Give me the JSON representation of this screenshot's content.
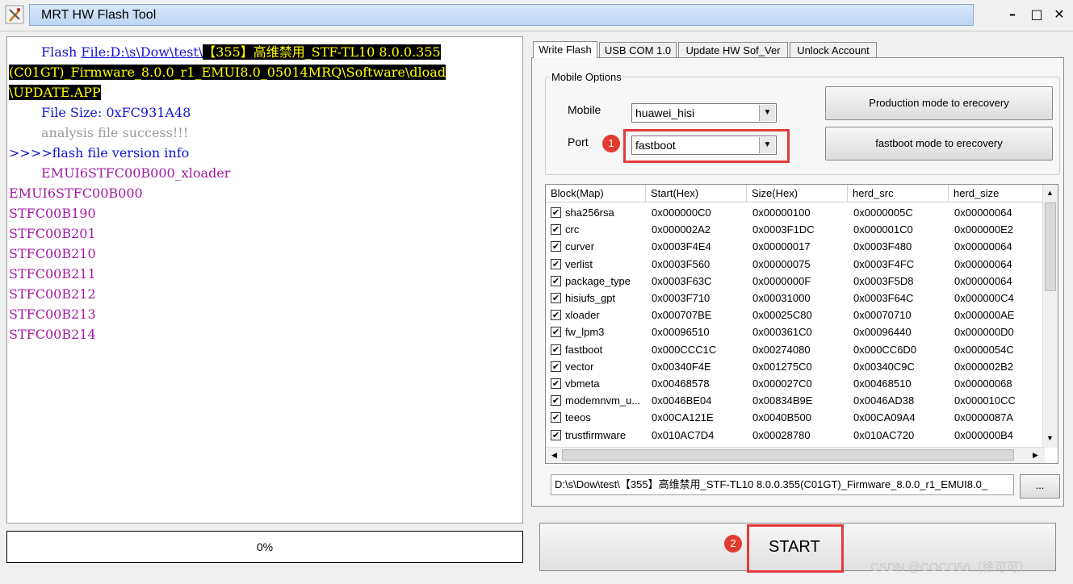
{
  "window": {
    "title": "MRT HW Flash Tool",
    "buttons": [
      "–",
      "□",
      "✕"
    ]
  },
  "log": {
    "lines": [
      {
        "prefix": "Flash ",
        "link": "File:D:\\s\\Dow\\test\\",
        "hl": "【355】高维禁用_STF-TL10 8.0.0.355"
      },
      {
        "hl": "(C01GT)_Firmware_8.0.0_r1_EMUI8.0_05014MRQ\\Software\\dload"
      },
      {
        "hl": "\\UPDATE.APP"
      },
      {
        "text": "File Size: 0xFC931A48",
        "color": "blue"
      },
      {
        "text": "analysis file success!!!",
        "color": "gray"
      },
      {
        "text": ">>>>flash file version info",
        "color": "blue"
      },
      {
        "text": "EMUI6STFC00B000_xloader",
        "color": "purple"
      },
      {
        "text": "EMUI6STFC00B000",
        "color": "purple"
      },
      {
        "text": "STFC00B190",
        "color": "purple"
      },
      {
        "text": "STFC00B201",
        "color": "purple"
      },
      {
        "text": "STFC00B210",
        "color": "purple"
      },
      {
        "text": "STFC00B211",
        "color": "purple"
      },
      {
        "text": "STFC00B212",
        "color": "purple"
      },
      {
        "text": "STFC00B213",
        "color": "purple"
      },
      {
        "text": "STFC00B214",
        "color": "purple"
      }
    ]
  },
  "progress": {
    "label": "0%",
    "value": 0
  },
  "tabs": [
    "Write Flash",
    "USB COM 1.0",
    "Update HW Sof_Ver",
    "Unlock Account"
  ],
  "mobile_options": {
    "group_label": "Mobile Options",
    "mobile_label": "Mobile",
    "mobile_value": "huawei_hisi",
    "port_label": "Port",
    "port_value": "fastboot",
    "production_button": "Production mode to erecovery",
    "fastboot_button": "fastboot mode to erecovery"
  },
  "badges": {
    "one": "1",
    "two": "2"
  },
  "table": {
    "headers": [
      "Block(Map)",
      "Start(Hex)",
      "Size(Hex)",
      "herd_src",
      "herd_size"
    ],
    "rows": [
      [
        "sha256rsa",
        "0x000000C0",
        "0x00000100",
        "0x0000005C",
        "0x00000064"
      ],
      [
        "crc",
        "0x000002A2",
        "0x0003F1DC",
        "0x000001C0",
        "0x000000E2"
      ],
      [
        "curver",
        "0x0003F4E4",
        "0x00000017",
        "0x0003F480",
        "0x00000064"
      ],
      [
        "verlist",
        "0x0003F560",
        "0x00000075",
        "0x0003F4FC",
        "0x00000064"
      ],
      [
        "package_type",
        "0x0003F63C",
        "0x0000000F",
        "0x0003F5D8",
        "0x00000064"
      ],
      [
        "hisiufs_gpt",
        "0x0003F710",
        "0x00031000",
        "0x0003F64C",
        "0x000000C4"
      ],
      [
        "xloader",
        "0x000707BE",
        "0x00025C80",
        "0x00070710",
        "0x000000AE"
      ],
      [
        "fw_lpm3",
        "0x00096510",
        "0x000361C0",
        "0x00096440",
        "0x000000D0"
      ],
      [
        "fastboot",
        "0x000CCC1C",
        "0x00274080",
        "0x000CC6D0",
        "0x0000054C"
      ],
      [
        "vector",
        "0x00340F4E",
        "0x001275C0",
        "0x00340C9C",
        "0x000002B2"
      ],
      [
        "vbmeta",
        "0x00468578",
        "0x000027C0",
        "0x00468510",
        "0x00000068"
      ],
      [
        "modemnvm_u...",
        "0x0046BE04",
        "0x00834B9E",
        "0x0046AD38",
        "0x000010CC"
      ],
      [
        "teeos",
        "0x00CA121E",
        "0x0040B500",
        "0x00CA09A4",
        "0x0000087A"
      ],
      [
        "trustfirmware",
        "0x010AC7D4",
        "0x00028780",
        "0x010AC720",
        "0x000000B4"
      ]
    ]
  },
  "path_field": "D:\\s\\Dow\\test\\【355】高维禁用_STF-TL10 8.0.0.355(C01GT)_Firmware_8.0.0_r1_EMUI8.0_",
  "browse_label": "...",
  "start_label": "START",
  "watermark": "CSDN @COCO56（徐可可）"
}
